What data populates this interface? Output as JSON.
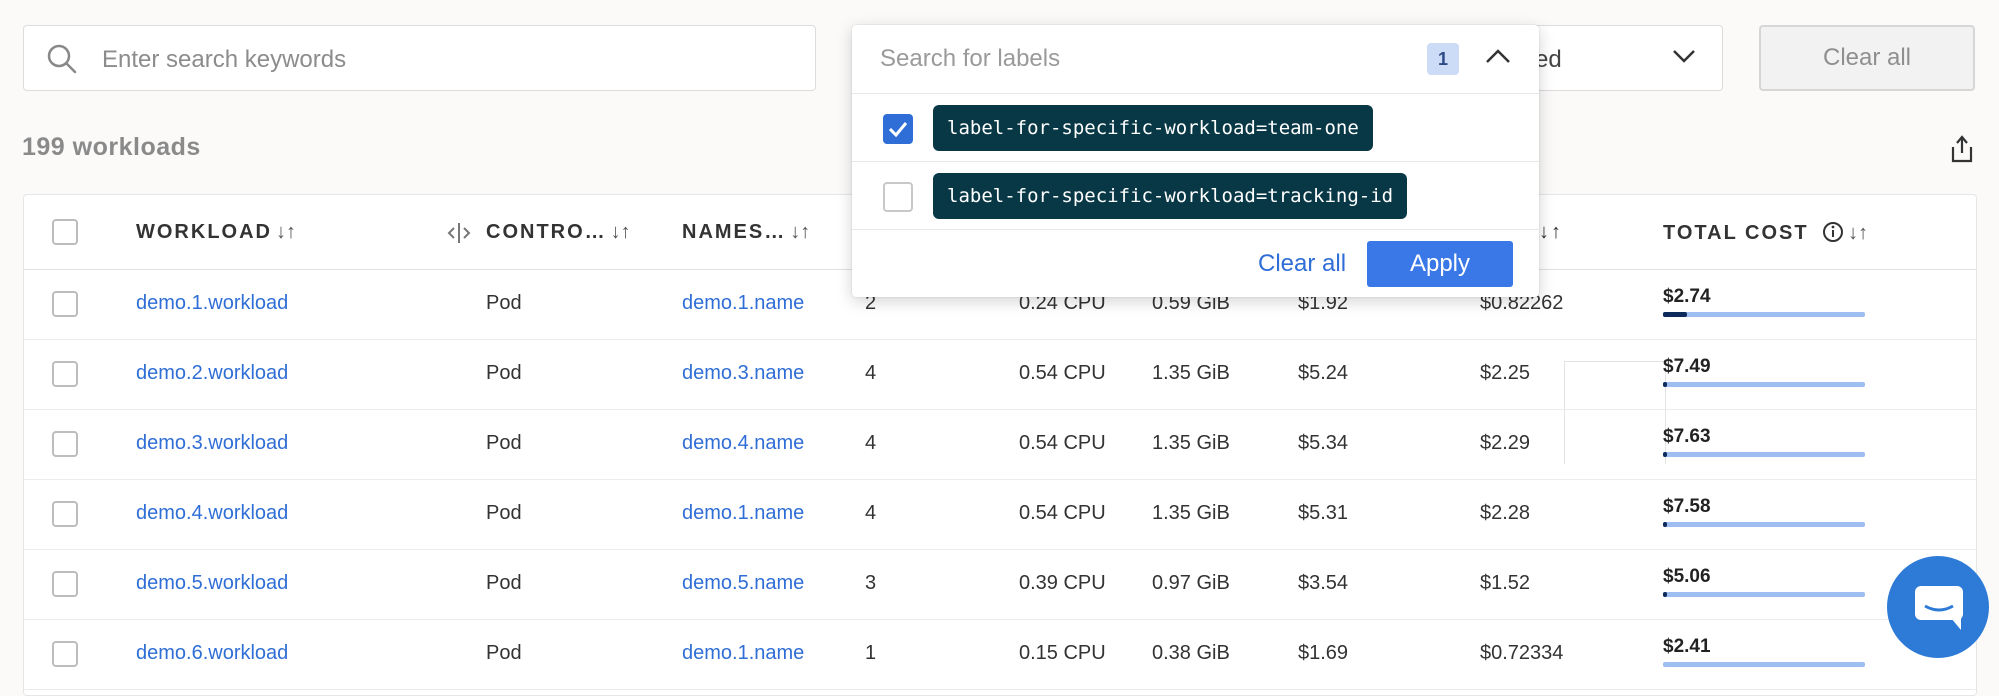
{
  "search": {
    "placeholder": "Enter search keywords"
  },
  "filter_select": {
    "value_fragment": "ed"
  },
  "toolbar": {
    "clear_all": "Clear all"
  },
  "summary": {
    "count_label": "199 workloads"
  },
  "columns": {
    "workload": "WORKLOAD",
    "controller": "CONTRO…",
    "namespace": "NAMES…",
    "total_cost": "TOTAL COST"
  },
  "label_dropdown": {
    "placeholder": "Search for labels",
    "selected_count": "1",
    "options": [
      {
        "label": "label-for-specific-workload=team-one",
        "checked": true
      },
      {
        "label": "label-for-specific-workload=tracking-id",
        "checked": false
      }
    ],
    "clear_all": "Clear all",
    "apply": "Apply"
  },
  "rows": [
    {
      "workload": "demo.1.workload",
      "controller": "Pod",
      "namespace": "demo.1.name",
      "pods": "2",
      "cpu": "0.24 CPU",
      "memory": "0.59 GiB",
      "cost_a": "$1.92",
      "cost_b": "$0.82262",
      "total_cost": "$2.74",
      "cost_fraction": 0.12
    },
    {
      "workload": "demo.2.workload",
      "controller": "Pod",
      "namespace": "demo.3.name",
      "pods": "4",
      "cpu": "0.54 CPU",
      "memory": "1.35 GiB",
      "cost_a": "$5.24",
      "cost_b": "$2.25",
      "total_cost": "$7.49",
      "cost_fraction": 0.02
    },
    {
      "workload": "demo.3.workload",
      "controller": "Pod",
      "namespace": "demo.4.name",
      "pods": "4",
      "cpu": "0.54 CPU",
      "memory": "1.35 GiB",
      "cost_a": "$5.34",
      "cost_b": "$2.29",
      "total_cost": "$7.63",
      "cost_fraction": 0.02
    },
    {
      "workload": "demo.4.workload",
      "controller": "Pod",
      "namespace": "demo.1.name",
      "pods": "4",
      "cpu": "0.54 CPU",
      "memory": "1.35 GiB",
      "cost_a": "$5.31",
      "cost_b": "$2.28",
      "total_cost": "$7.58",
      "cost_fraction": 0.02
    },
    {
      "workload": "demo.5.workload",
      "controller": "Pod",
      "namespace": "demo.5.name",
      "pods": "3",
      "cpu": "0.39 CPU",
      "memory": "0.97 GiB",
      "cost_a": "$3.54",
      "cost_b": "$1.52",
      "total_cost": "$5.06",
      "cost_fraction": 0.02
    },
    {
      "workload": "demo.6.workload",
      "controller": "Pod",
      "namespace": "demo.1.name",
      "pods": "1",
      "cpu": "0.15 CPU",
      "memory": "0.38 GiB",
      "cost_a": "$1.69",
      "cost_b": "$0.72334",
      "total_cost": "$2.41",
      "cost_fraction": 0.0
    }
  ],
  "icons": {
    "search": "search-icon",
    "export": "export-icon",
    "chat": "chat-icon",
    "info": "info-icon"
  },
  "colors": {
    "link": "#2f6ed6",
    "chip_bg": "#083846",
    "apply_bg": "#3b78e7",
    "bar_track": "#9ebdf0",
    "bar_fill": "#0e2a5a",
    "chat_bg": "#2d7bd6"
  }
}
